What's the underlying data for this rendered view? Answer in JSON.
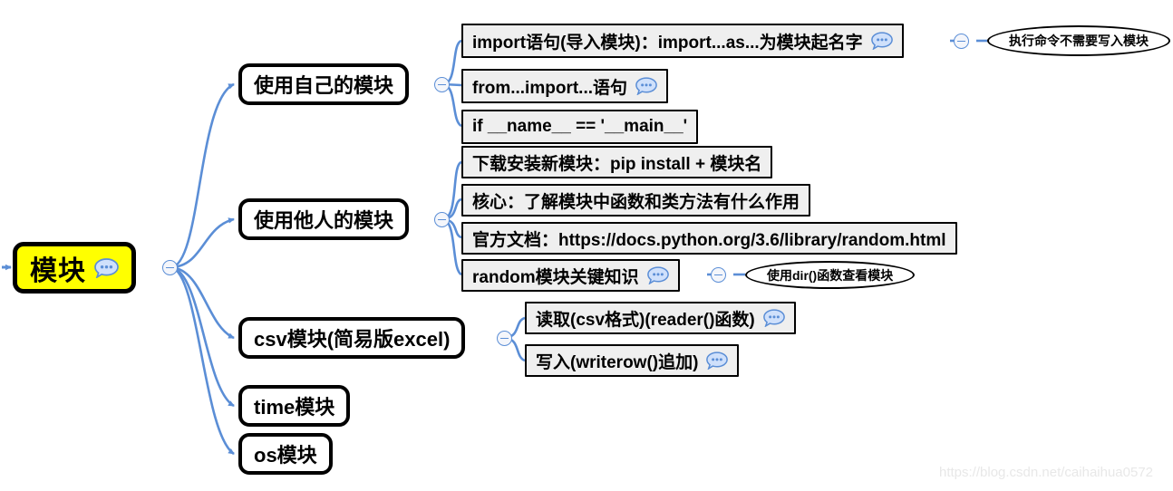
{
  "colors": {
    "root_fill": "#ffff00",
    "node_stroke": "#000000",
    "leaf_fill": "#efefef",
    "edge": "#5b8ed6",
    "note_icon": "#7aa9e9",
    "watermark": "#e8e8e8",
    "canvas": "#ffffff"
  },
  "root": {
    "label": "模块",
    "note_icon": "speech-bubble-icon"
  },
  "branches": [
    {
      "label": "使用自己的模块",
      "children": [
        {
          "label": "import语句(导入模块)：import...as...为模块起名字",
          "note_icon": "speech-bubble-icon",
          "callout": "执行命令不需要写入模块"
        },
        {
          "label": "from...import...语句",
          "note_icon": "speech-bubble-icon"
        },
        {
          "label": "if __name__ == '__main__'"
        }
      ]
    },
    {
      "label": "使用他人的模块",
      "children": [
        {
          "label": "下载安装新模块：pip install + 模块名"
        },
        {
          "label": "核心：了解模块中函数和类方法有什么作用"
        },
        {
          "label": "官方文档：https://docs.python.org/3.6/library/random.html"
        },
        {
          "label": "random模块关键知识",
          "note_icon": "speech-bubble-icon",
          "callout": "使用dir()函数查看模块"
        }
      ]
    },
    {
      "label": "csv模块(简易版excel)",
      "children": [
        {
          "label": "读取(csv格式)(reader()函数)",
          "note_icon": "speech-bubble-icon"
        },
        {
          "label": "写入(writerow()追加)",
          "note_icon": "speech-bubble-icon"
        }
      ]
    },
    {
      "label": "time模块",
      "children": []
    },
    {
      "label": "os模块",
      "children": []
    }
  ],
  "watermark": "https://blog.csdn.net/caihaihua0572"
}
